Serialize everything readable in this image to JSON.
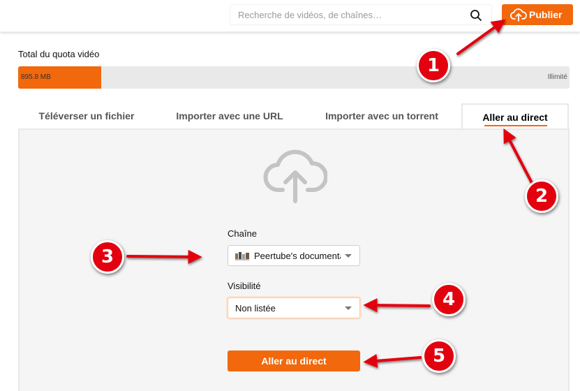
{
  "header": {
    "search_placeholder": "Recherche de vidéos, de chaînes…",
    "publish_label": "Publier"
  },
  "quota": {
    "title": "Total du quota vidéo",
    "used": "895.8 MB",
    "max": "Illimité",
    "fill_fraction": 0.15
  },
  "tabs": [
    {
      "label": "Téléverser un fichier",
      "active": false
    },
    {
      "label": "Importer avec une URL",
      "active": false
    },
    {
      "label": "Importer avec un torrent",
      "active": false
    },
    {
      "label": "Aller au direct",
      "active": true
    }
  ],
  "form": {
    "channel_label": "Chaîne",
    "channel_value": "Peertube's documentation",
    "visibility_label": "Visibilité",
    "visibility_value": "Non listée",
    "submit_label": "Aller au direct"
  },
  "annotations": [
    "1",
    "2",
    "3",
    "4",
    "5"
  ],
  "colors": {
    "accent": "#f1680d",
    "annotation": "#e3000f"
  }
}
